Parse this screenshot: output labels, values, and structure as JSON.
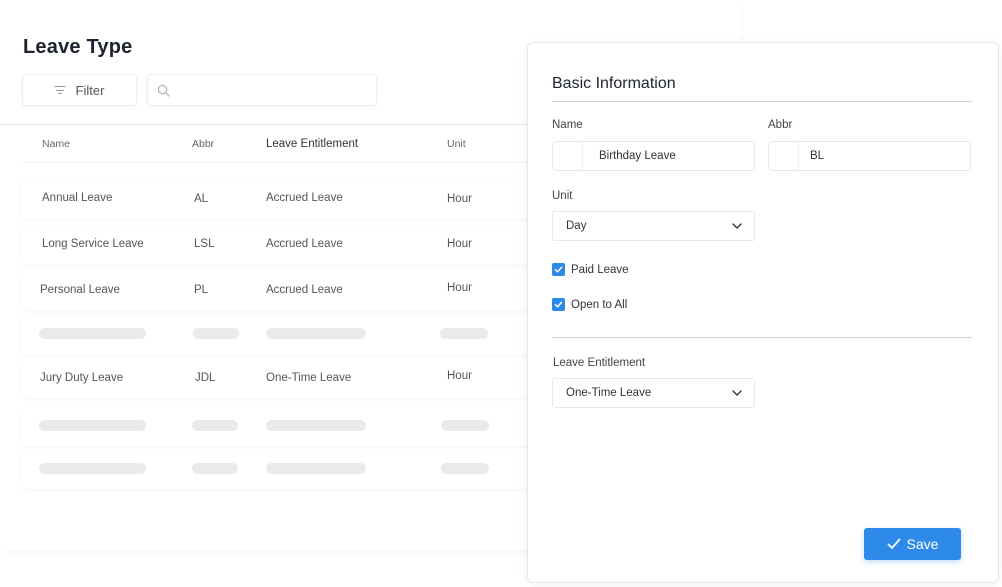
{
  "page": {
    "title": "Leave Type"
  },
  "toolbar": {
    "filter_label": "Filter",
    "search_value": ""
  },
  "table": {
    "headers": {
      "name": "Name",
      "abbr": "Abbr",
      "entitlement": "Leave Entitlement",
      "unit": "Unit"
    },
    "rows": [
      {
        "name": "Annual Leave",
        "abbr": "AL",
        "entitlement": "Accrued Leave",
        "unit": "Hour"
      },
      {
        "name": "Long Service Leave",
        "abbr": "LSL",
        "entitlement": "Accrued Leave",
        "unit": "Hour"
      },
      {
        "name": "Personal Leave",
        "abbr": "PL",
        "entitlement": "Accrued Leave",
        "unit": "Hour"
      },
      {
        "placeholder": true
      },
      {
        "name": "Jury Duty Leave",
        "abbr": "JDL",
        "entitlement": "One-Time Leave",
        "unit": "Hour"
      },
      {
        "placeholder": true
      },
      {
        "placeholder": true
      }
    ]
  },
  "panel": {
    "title": "Basic Information",
    "name_label": "Name",
    "name_value": "Birthday Leave",
    "abbr_label": "Abbr",
    "abbr_value": "BL",
    "unit_label": "Unit",
    "unit_value": "Day",
    "paid_leave_label": "Paid Leave",
    "paid_leave_checked": true,
    "open_to_all_label": "Open to All",
    "open_to_all_checked": true,
    "entitlement_label": "Leave Entitlement",
    "entitlement_value": "One-Time Leave",
    "save_label": "Save"
  },
  "icons": {
    "filter": "filter-icon",
    "search": "search-icon",
    "chevron": "chevron-down-icon",
    "check": "check-icon"
  },
  "colors": {
    "accent": "#2d8ae8",
    "skeleton": "#e9eaec"
  }
}
